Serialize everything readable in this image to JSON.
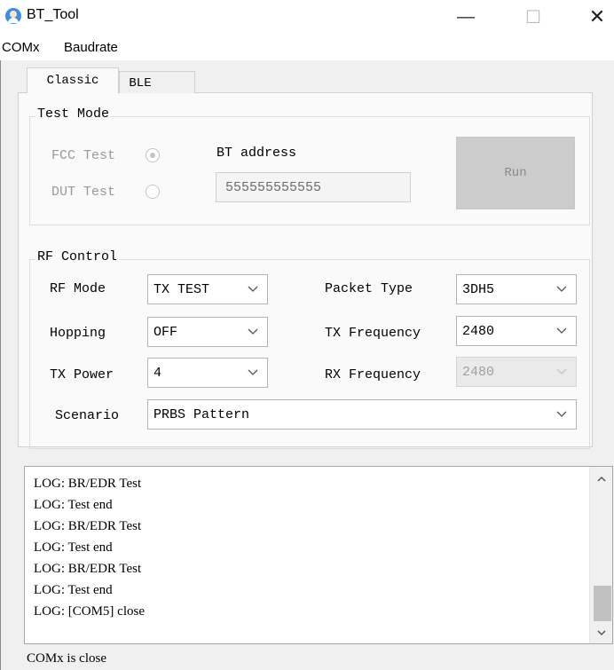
{
  "window": {
    "title": "BT_Tool",
    "controls": {
      "minimize": "—",
      "maximize": "☐",
      "close": "✕"
    }
  },
  "menu": {
    "items": [
      "COMx",
      "Baudrate"
    ]
  },
  "tabs": [
    {
      "label": "Classic",
      "selected": true
    },
    {
      "label": "BLE",
      "selected": false
    }
  ],
  "test_mode": {
    "legend": "Test Mode",
    "fcc_label": "FCC Test",
    "dut_label": "DUT Test",
    "fcc_checked": true,
    "dut_checked": false,
    "bt_address_label": "BT address",
    "bt_address_value": "555555555555",
    "run_label": "Run"
  },
  "rf_control": {
    "legend": "RF Control",
    "rf_mode_label": "RF Mode",
    "rf_mode_value": "TX TEST",
    "hopping_label": "Hopping",
    "hopping_value": "OFF",
    "tx_power_label": "TX Power",
    "tx_power_value": "4",
    "packet_type_label": "Packet Type",
    "packet_type_value": "3DH5",
    "tx_freq_label": "TX Frequency",
    "tx_freq_value": "2480",
    "rx_freq_label": "RX Frequency",
    "rx_freq_value": "2480",
    "scenario_label": "Scenario",
    "scenario_value": "PRBS Pattern"
  },
  "log": {
    "lines": [
      "LOG: BR/EDR Test",
      "LOG: Test end",
      "LOG: BR/EDR Test",
      "LOG: Test end",
      "LOG: BR/EDR Test",
      "LOG: Test end",
      "LOG: [COM5] close"
    ]
  },
  "status": {
    "text": "COMx is close"
  },
  "icons": {
    "app": "app-icon",
    "chevron": "chevron-down-icon",
    "scroll_up": "scroll-up-icon",
    "scroll_down": "scroll-down-icon"
  },
  "colors": {
    "app_icon": "#3a8ee6",
    "window_bg": "#f0f0f0",
    "disabled_button": "#cccccc"
  }
}
